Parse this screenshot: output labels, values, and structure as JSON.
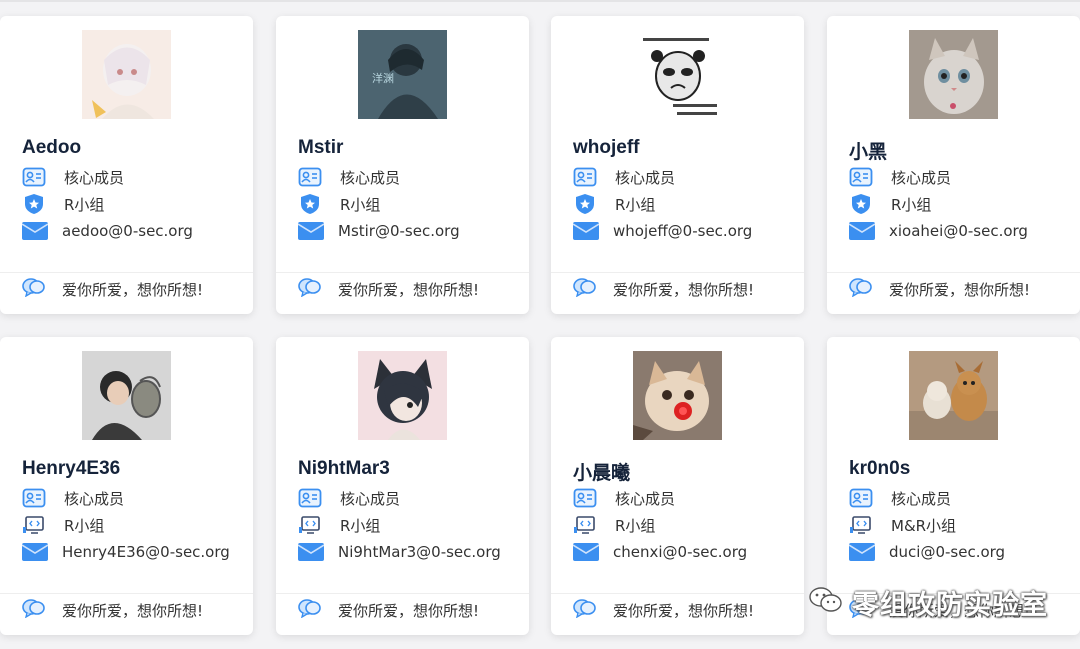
{
  "members": [
    {
      "name": "Aedoo",
      "role": "核心成员",
      "team": "R小组",
      "team_icon": "shield-icon",
      "email": "aedoo@0-sec.org",
      "motto": "爱你所爱，想你所想!"
    },
    {
      "name": "Mstir",
      "role": "核心成员",
      "team": "R小组",
      "team_icon": "shield-icon",
      "email": "Mstir@0-sec.org",
      "motto": "爱你所爱，想你所想!"
    },
    {
      "name": "whojeff",
      "role": "核心成员",
      "team": "R小组",
      "team_icon": "shield-icon",
      "email": "whojeff@0-sec.org",
      "motto": "爱你所爱，想你所想!"
    },
    {
      "name": "小黑",
      "role": "核心成员",
      "team": "R小组",
      "team_icon": "shield-icon",
      "email": "xioahei@0-sec.org",
      "motto": "爱你所爱，想你所想!"
    },
    {
      "name": "Henry4E36",
      "role": "核心成员",
      "team": "R小组",
      "team_icon": "code-monitor-icon",
      "email": "Henry4E36@0-sec.org",
      "motto": "爱你所爱，想你所想!"
    },
    {
      "name": "Ni9htMar3",
      "role": "核心成员",
      "team": "R小组",
      "team_icon": "code-monitor-icon",
      "email": "Ni9htMar3@0-sec.org",
      "motto": "爱你所爱，想你所想!"
    },
    {
      "name": "小晨曦",
      "role": "核心成员",
      "team": "R小组",
      "team_icon": "code-monitor-icon",
      "email": "chenxi@0-sec.org",
      "motto": "爱你所爱，想你所想!"
    },
    {
      "name": "kr0n0s",
      "role": "核心成员",
      "team": "M&R小组",
      "team_icon": "code-monitor-icon",
      "email": "duci@0-sec.org",
      "motto": "爱你所爱，想你所想!"
    }
  ],
  "watermark": {
    "text": "零组攻防实验室",
    "icon": "wechat-icon"
  },
  "colors": {
    "accent": "#3b8ff0",
    "card": "#ffffff",
    "background": "#f3f3f5",
    "name": "#15233a"
  }
}
